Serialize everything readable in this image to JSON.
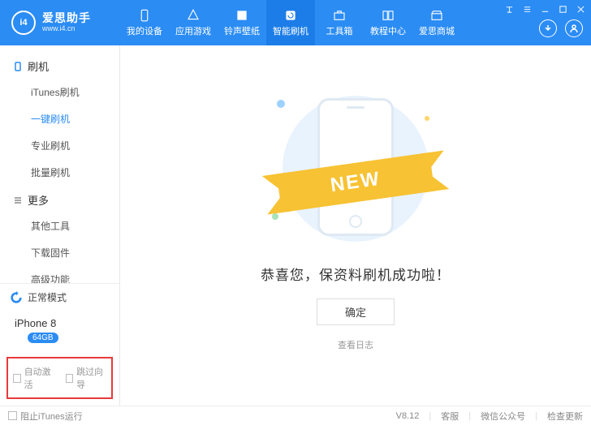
{
  "logo": {
    "short": "i4",
    "title": "爱思助手",
    "url": "www.i4.cn"
  },
  "nav": {
    "devices": "我的设备",
    "games": "应用游戏",
    "ringtones": "铃声壁纸",
    "flash": "智能刷机",
    "toolbox": "工具箱",
    "tutorials": "教程中心",
    "store": "爱思商城"
  },
  "sidebar": {
    "groups": {
      "flash": {
        "title": "刷机",
        "items": {
          "itunes": "iTunes刷机",
          "onekey": "一键刷机",
          "pro": "专业刷机",
          "batch": "批量刷机"
        }
      },
      "more": {
        "title": "更多",
        "items": {
          "tools": "其他工具",
          "download": "下载固件",
          "advanced": "高级功能"
        }
      }
    },
    "status": "正常模式",
    "device": {
      "name": "iPhone 8",
      "storage": "64GB"
    },
    "checks": {
      "auto_activate": "自动激活",
      "skip_guide": "跳过向导"
    }
  },
  "main": {
    "ribbon": "NEW",
    "success": "恭喜您，保资料刷机成功啦！",
    "ok": "确定",
    "log": "查看日志"
  },
  "footer": {
    "block_itunes": "阻止iTunes运行",
    "version": "V8.12",
    "service": "客服",
    "wechat": "微信公众号",
    "update": "检查更新"
  }
}
